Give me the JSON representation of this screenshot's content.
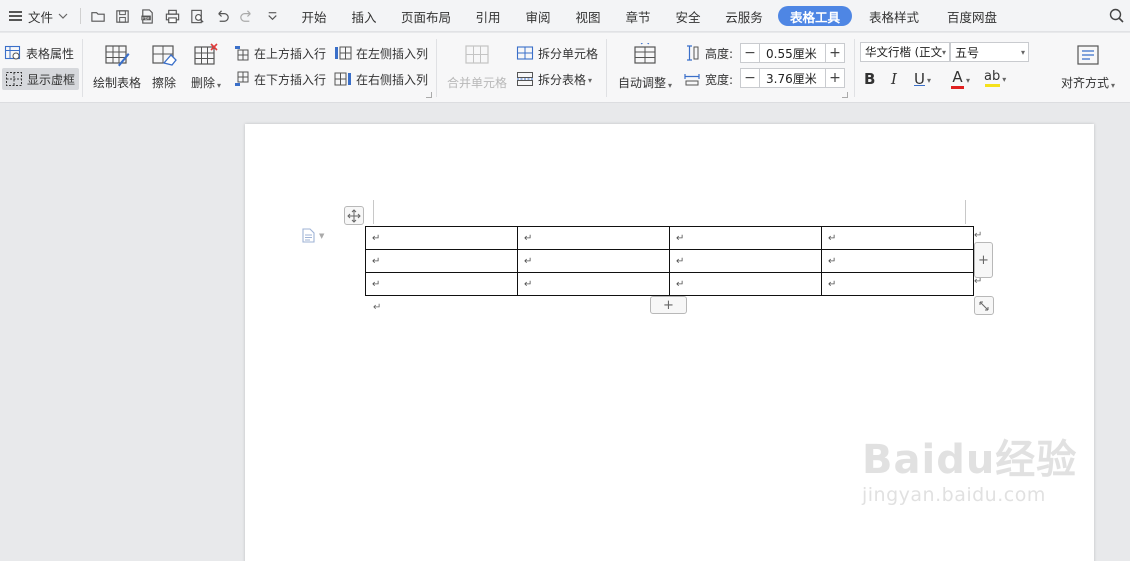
{
  "menubar": {
    "file_label": "文件",
    "tabs": [
      {
        "label": "开始"
      },
      {
        "label": "插入"
      },
      {
        "label": "页面布局"
      },
      {
        "label": "引用"
      },
      {
        "label": "审阅"
      },
      {
        "label": "视图"
      },
      {
        "label": "章节"
      },
      {
        "label": "安全"
      },
      {
        "label": "云服务"
      },
      {
        "label": "表格工具",
        "active": true
      },
      {
        "label": "表格样式"
      },
      {
        "label": "百度网盘"
      }
    ],
    "accent_color": "#4e86e4"
  },
  "ribbon": {
    "table_properties": "表格属性",
    "show_gridlines": "显示虚框",
    "draw_table": "绘制表格",
    "erase": "擦除",
    "delete": "删除",
    "insert_row_above": "在上方插入行",
    "insert_row_below": "在下方插入行",
    "insert_col_left": "在左侧插入列",
    "insert_col_right": "在右侧插入列",
    "merge_cells": "合并单元格",
    "split_cells": "拆分单元格",
    "split_table": "拆分表格",
    "auto_fit": "自动调整",
    "height_label": "高度:",
    "height_value": "0.55厘米",
    "width_label": "宽度:",
    "width_value": "3.76厘米",
    "font_family": "华文行楷 (正文",
    "font_size": "五号",
    "bold": "B",
    "italic": "I",
    "underline": "U",
    "font_color_letter": "A",
    "highlight_letters": "ab",
    "align": "对齐方式"
  },
  "document": {
    "table_rows": 3,
    "table_cols": 4,
    "para_mark": "↵",
    "add": "+"
  },
  "watermark": {
    "brand": "Baidu经验",
    "url": "jingyan.baidu.com"
  }
}
